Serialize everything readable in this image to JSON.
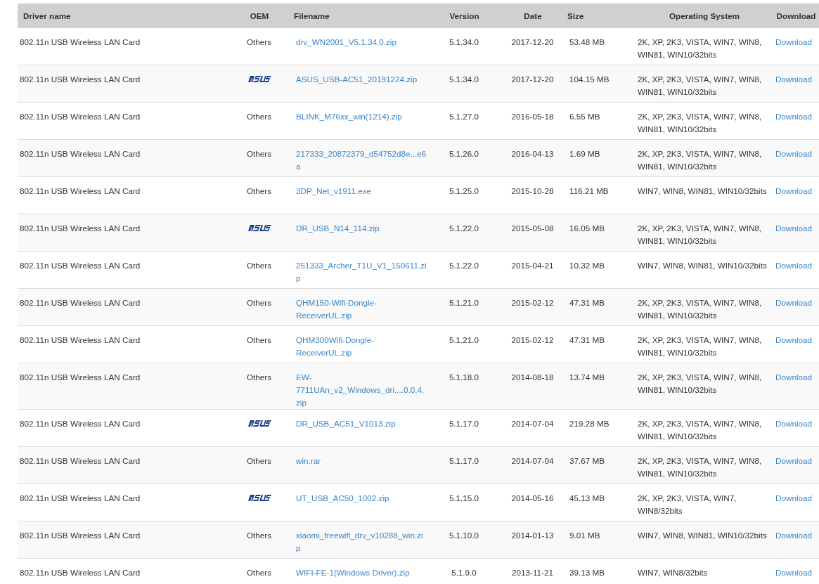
{
  "table": {
    "columns": [
      "Driver name",
      "OEM",
      "Filename",
      "Version",
      "Date",
      "Size",
      "Operating System",
      "Download"
    ],
    "rows": [
      {
        "driver": "802.11n USB Wireless LAN Card",
        "oem": {
          "kind": "text",
          "label": "Others"
        },
        "filename": "drv_WN2001_V5.1.34.0.zip",
        "version": "5.1.34.0",
        "date": "2017-12-20",
        "size": "53.48 MB",
        "os": "2K, XP, 2K3, VISTA, WIN7, WIN8, WIN81, WIN10/32bits",
        "download": "Download"
      },
      {
        "driver": "802.11n USB Wireless LAN Card",
        "oem": {
          "kind": "logo"
        },
        "filename": "ASUS_USB-AC51_20191224.zip",
        "version": "5.1.34.0",
        "date": "2017-12-20",
        "size": "104.15 MB",
        "os": "2K, XP, 2K3, VISTA, WIN7, WIN8, WIN81, WIN10/32bits",
        "download": "Download"
      },
      {
        "driver": "802.11n USB Wireless LAN Card",
        "oem": {
          "kind": "text",
          "label": "Others"
        },
        "filename": "BLINK_M76xx_win(1214).zip",
        "version": "5.1.27.0",
        "date": "2016-05-18",
        "size": "6.55 MB",
        "os": "2K, XP, 2K3, VISTA, WIN7, WIN8, WIN81, WIN10/32bits",
        "download": "Download"
      },
      {
        "driver": "802.11n USB Wireless LAN Card",
        "oem": {
          "kind": "text",
          "label": "Others"
        },
        "filename": "217333_20872379_d54752d8e...e6a",
        "version": "5.1.26.0",
        "date": "2016-04-13",
        "size": "1.69 MB",
        "os": "2K, XP, 2K3, VISTA, WIN7, WIN8, WIN81, WIN10/32bits",
        "download": "Download"
      },
      {
        "driver": "802.11n USB Wireless LAN Card",
        "oem": {
          "kind": "text",
          "label": "Others"
        },
        "filename": "3DP_Net_v1911.exe",
        "version": "5.1.25.0",
        "date": "2015-10-28",
        "size": "116.21 MB",
        "os": "WIN7, WIN8, WIN81, WIN10/32bits",
        "download": "Download"
      },
      {
        "driver": "802.11n USB Wireless LAN Card",
        "oem": {
          "kind": "logo"
        },
        "filename": "DR_USB_N14_114.zip",
        "version": "5.1.22.0",
        "date": "2015-05-08",
        "size": "16.05 MB",
        "os": "2K, XP, 2K3, VISTA, WIN7, WIN8, WIN81, WIN10/32bits",
        "download": "Download"
      },
      {
        "driver": "802.11n USB Wireless LAN Card",
        "oem": {
          "kind": "text",
          "label": "Others"
        },
        "filename": "251333_Archer_T1U_V1_150611.zip",
        "version": "5.1.22.0",
        "date": "2015-04-21",
        "size": "10.32 MB",
        "os": "WIN7, WIN8, WIN81, WIN10/32bits",
        "download": "Download"
      },
      {
        "driver": "802.11n USB Wireless LAN Card",
        "oem": {
          "kind": "text",
          "label": "Others"
        },
        "filename": "QHM150-Wifi-Dongle-ReceiverUL.zip",
        "version": "5.1.21.0",
        "date": "2015-02-12",
        "size": "47.31 MB",
        "os": "2K, XP, 2K3, VISTA, WIN7, WIN8, WIN81, WIN10/32bits",
        "download": "Download"
      },
      {
        "driver": "802.11n USB Wireless LAN Card",
        "oem": {
          "kind": "text",
          "label": "Others"
        },
        "filename": "QHM300Wifi-Dongle-ReceiverUL.zip",
        "version": "5.1.21.0",
        "date": "2015-02-12",
        "size": "47.31 MB",
        "os": "2K, XP, 2K3, VISTA, WIN7, WIN8, WIN81, WIN10/32bits",
        "download": "Download"
      },
      {
        "driver": "802.11n USB Wireless LAN Card",
        "oem": {
          "kind": "text",
          "label": "Others"
        },
        "filename": "EW-7711UAn_v2_Windows_dri....0.0.4.zip",
        "version": "5.1.18.0",
        "date": "2014-08-18",
        "size": "13.74 MB",
        "os": "2K, XP, 2K3, VISTA, WIN7, WIN8, WIN81, WIN10/32bits",
        "download": "Download"
      },
      {
        "driver": "802.11n USB Wireless LAN Card",
        "oem": {
          "kind": "logo"
        },
        "filename": "DR_USB_AC51_V1013.zip",
        "version": "5.1.17.0",
        "date": "2014-07-04",
        "size": "219.28 MB",
        "os": "2K, XP, 2K3, VISTA, WIN7, WIN8, WIN81, WIN10/32bits",
        "download": "Download"
      },
      {
        "driver": "802.11n USB Wireless LAN Card",
        "oem": {
          "kind": "text",
          "label": "Others"
        },
        "filename": "win.rar",
        "version": "5.1.17.0",
        "date": "2014-07-04",
        "size": "37.67 MB",
        "os": "2K, XP, 2K3, VISTA, WIN7, WIN8, WIN81, WIN10/32bits",
        "download": "Download"
      },
      {
        "driver": "802.11n USB Wireless LAN Card",
        "oem": {
          "kind": "logo"
        },
        "filename": "UT_USB_AC50_1002.zip",
        "version": "5.1.15.0",
        "date": "2014-05-16",
        "size": "45.13 MB",
        "os": "2K, XP, 2K3, VISTA, WIN7, WIN8/32bits",
        "download": "Download"
      },
      {
        "driver": "802.11n USB Wireless LAN Card",
        "oem": {
          "kind": "text",
          "label": "Others"
        },
        "filename": "xiaomi_freewifi_drv_v10288_win.zip",
        "version": "5.1.10.0",
        "date": "2014-01-13",
        "size": "9.01 MB",
        "os": "WIN7, WIN8, WIN81, WIN10/32bits",
        "download": "Download"
      },
      {
        "driver": "802.11n USB Wireless LAN Card",
        "oem": {
          "kind": "text",
          "label": "Others"
        },
        "filename": "WIFI-FE-1(Windows Driver).zip",
        "version": "5.1.9.0",
        "date": "2013-11-21",
        "size": "39.13 MB",
        "os": "WIN7, WIN8/32bits",
        "download": "Download"
      }
    ]
  }
}
